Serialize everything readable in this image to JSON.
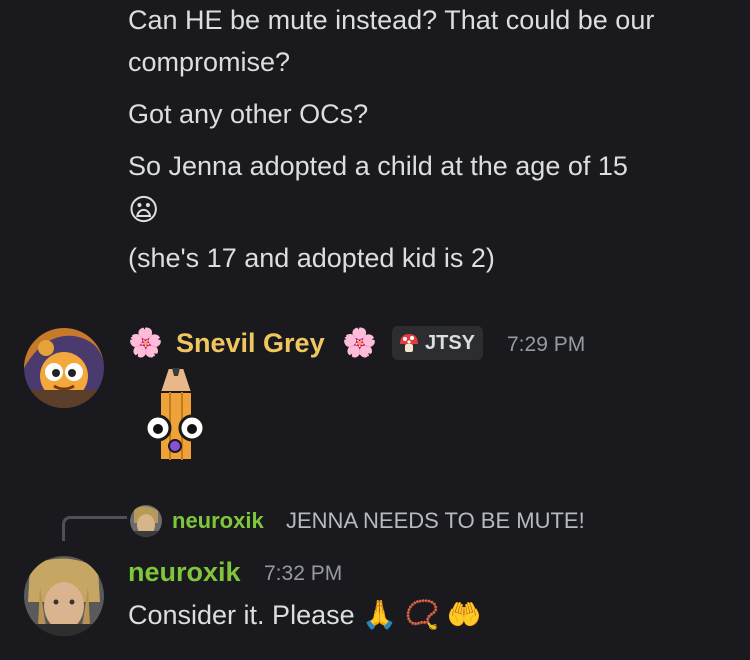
{
  "earlier_messages": [
    {
      "line1": "Can HE be mute instead? That could be our",
      "line2": "compromise?"
    },
    {
      "line1": "Got any other OCs?"
    },
    {
      "line1": "So Jenna adopted a child at the age of 15",
      "line2_emoji": "😦"
    },
    {
      "line1": "(she's 17 and adopted kid is 2)"
    }
  ],
  "message_snevil": {
    "prefix_emoji": "🌸",
    "username": "Snevil Grey",
    "suffix_emoji": "🌸",
    "tag_icon": "mushroom-icon",
    "tag_label": "JTSY",
    "timestamp": "7:29 PM",
    "content_type": "pencil-sticker",
    "name_color": "#f0c75e"
  },
  "reply": {
    "author": "neuroxik",
    "text": "JENNA NEEDS TO BE MUTE!",
    "author_color": "#7fc73a"
  },
  "message_neuroxik": {
    "username": "neuroxik",
    "timestamp": "7:32 PM",
    "text": "Consider it. Please",
    "emojis": [
      "🙏",
      "📿",
      "🤲"
    ],
    "name_color": "#7fc73a"
  },
  "colors": {
    "background": "#1a1a1e",
    "text": "#dbdee1",
    "muted": "#949ba4"
  }
}
